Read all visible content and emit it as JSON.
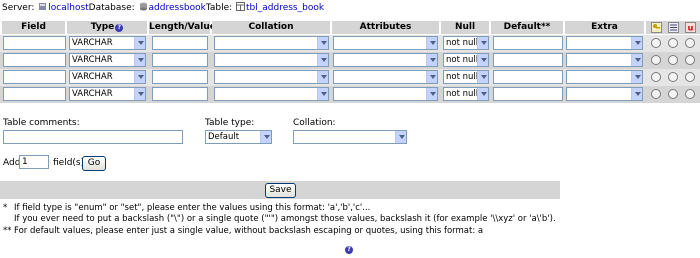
{
  "breadcrumb": {
    "server_label": "Server:",
    "server": "localhost",
    "database_label": "Database:",
    "database": "addressbook",
    "table_label": "Table:",
    "table": "tbl_address_book"
  },
  "headers": {
    "field": "Field",
    "type": "Type",
    "length": "Length/Values*",
    "collation": "Collation",
    "attributes": "Attributes",
    "null": "Null",
    "default": "Default**",
    "extra": "Extra"
  },
  "rows": [
    {
      "field": "",
      "type": "VARCHAR",
      "length": "",
      "collation": "",
      "attributes": "",
      "null": "not null",
      "default": "",
      "extra": ""
    },
    {
      "field": "",
      "type": "VARCHAR",
      "length": "",
      "collation": "",
      "attributes": "",
      "null": "not null",
      "default": "",
      "extra": ""
    },
    {
      "field": "",
      "type": "VARCHAR",
      "length": "",
      "collation": "",
      "attributes": "",
      "null": "not null",
      "default": "",
      "extra": ""
    },
    {
      "field": "",
      "type": "VARCHAR",
      "length": "",
      "collation": "",
      "attributes": "",
      "null": "not null",
      "default": "",
      "extra": ""
    }
  ],
  "table_options": {
    "comments_label": "Table comments:",
    "comments_value": "",
    "type_label": "Table type:",
    "type_value": "Default",
    "collation_label": "Collation:",
    "collation_value": ""
  },
  "add_fields": {
    "prefix": "Add",
    "count": "1",
    "suffix": "field(s)",
    "go_label": "Go"
  },
  "save_label": "Save",
  "notes": {
    "star1_marker": "*",
    "star1_line1": "If field type is \"enum\" or \"set\", please enter the values using this format: 'a','b','c'...",
    "star1_line2": "If you ever need to put a backslash (\"\\\") or a single quote (\"'\") amongst those values, backslash it (for example '\\\\xyz' or 'a\\'b').",
    "star2_marker": "**",
    "star2_line": "For default values, please enter just a single value, without backslash escaping or quotes, using this format: a"
  },
  "colors": {
    "header_bg": "#d5d5d5",
    "row_even": "#e5e5e5",
    "row_odd": "#d5d5d5",
    "link": "#0000cc"
  }
}
